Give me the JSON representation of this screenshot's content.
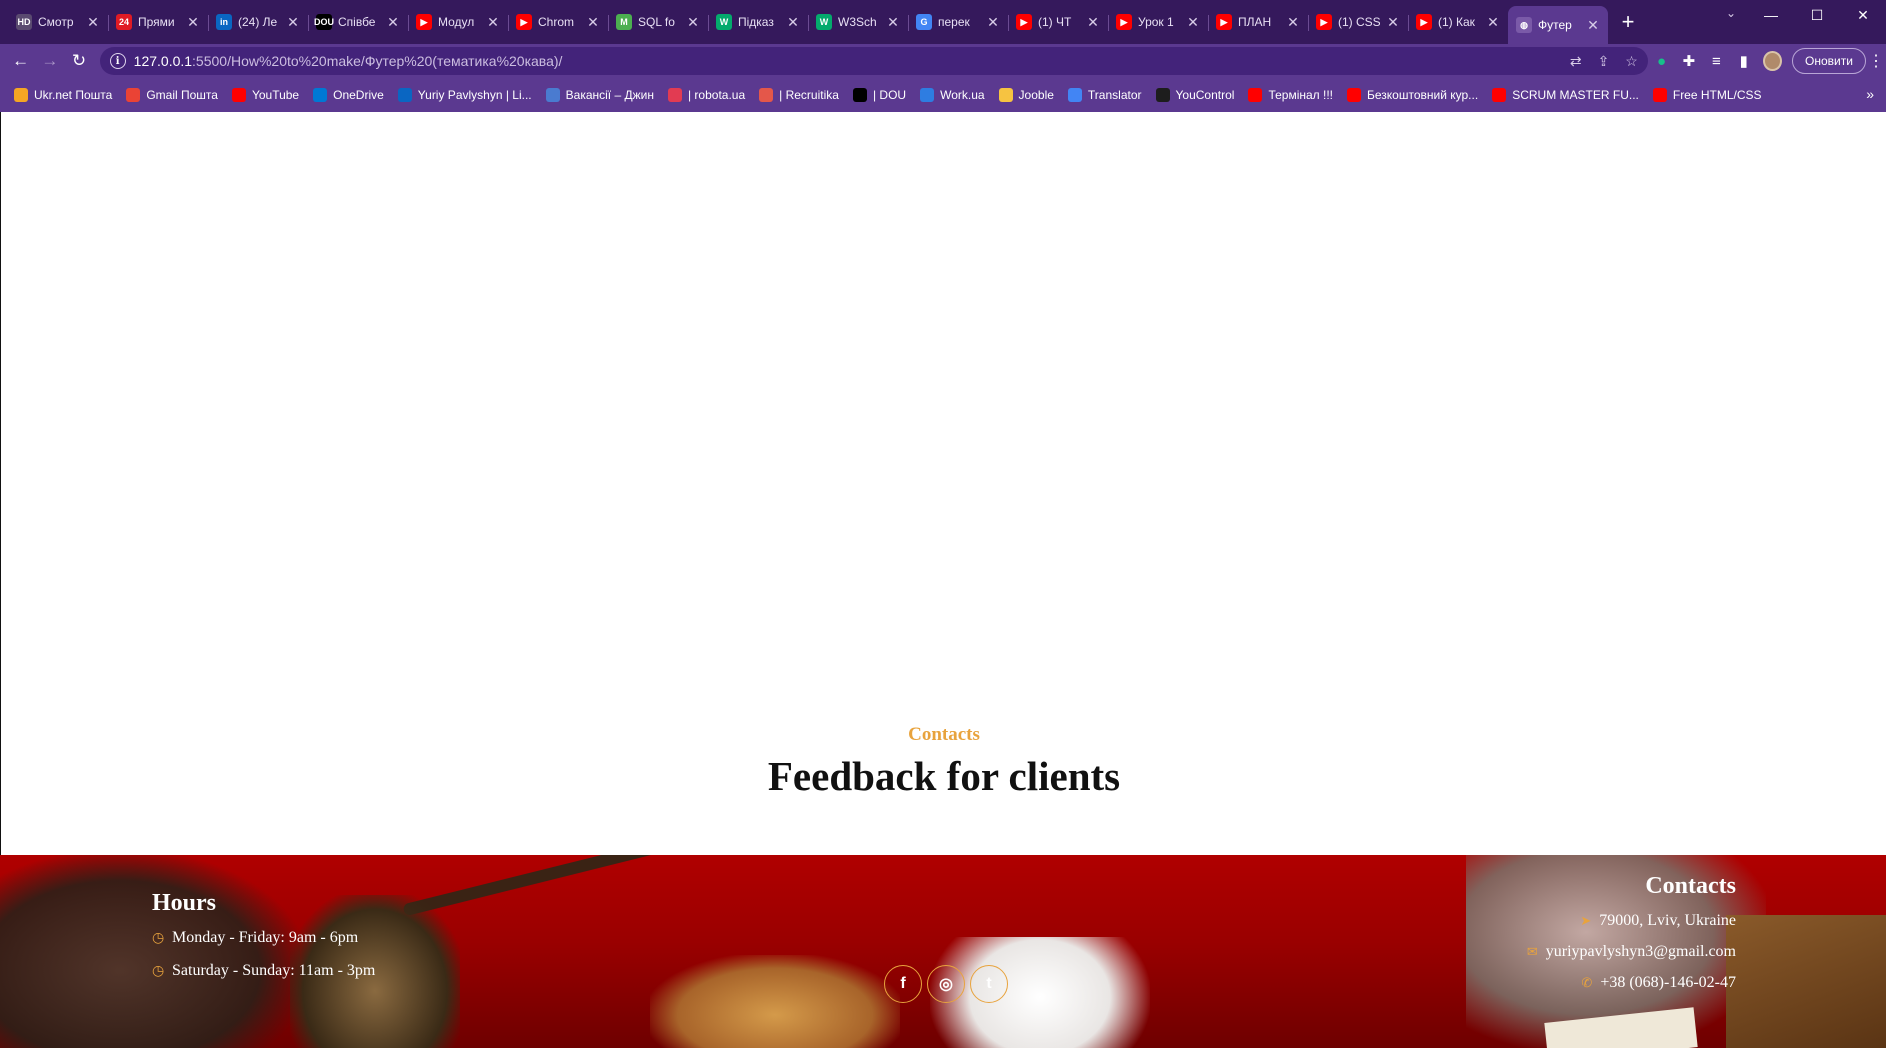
{
  "browser": {
    "tabs": [
      {
        "title": "Смотр",
        "fav": "HD",
        "fav_color": "#5a4a70"
      },
      {
        "title": "Прями",
        "fav": "24",
        "fav_color": "#e01b24"
      },
      {
        "title": "(24) Ле",
        "fav": "in",
        "fav_color": "#0a66c2"
      },
      {
        "title": "Співбе",
        "fav": "DOU",
        "fav_color": "#000000"
      },
      {
        "title": "Модул",
        "fav": "▶",
        "fav_color": "#ff0000"
      },
      {
        "title": "Chrom",
        "fav": "▶",
        "fav_color": "#ff0000"
      },
      {
        "title": "SQL fo",
        "fav": "M",
        "fav_color": "#4caf50"
      },
      {
        "title": "Підказ",
        "fav": "W",
        "fav_color": "#04aa6d"
      },
      {
        "title": "W3Sch",
        "fav": "W",
        "fav_color": "#04aa6d"
      },
      {
        "title": "перек",
        "fav": "G",
        "fav_color": "#4285f4"
      },
      {
        "title": "(1) ЧТ",
        "fav": "▶",
        "fav_color": "#ff0000"
      },
      {
        "title": "Урок 1",
        "fav": "▶",
        "fav_color": "#ff0000"
      },
      {
        "title": "ПЛАН",
        "fav": "▶",
        "fav_color": "#ff0000"
      },
      {
        "title": "(1) CSS",
        "fav": "▶",
        "fav_color": "#ff0000"
      },
      {
        "title": "(1) Как",
        "fav": "▶",
        "fav_color": "#ff0000"
      },
      {
        "title": "Футер",
        "fav": "◍",
        "fav_color": "#7a5aa8",
        "active": true
      }
    ],
    "url_host": "127.0.0.1",
    "url_path": ":5500/How%20to%20make/Футер%20(тематика%20кава)/",
    "update_label": "Оновити",
    "bookmarks": [
      {
        "label": "Ukr.net Пошта",
        "fav_color": "#f5a623"
      },
      {
        "label": "Gmail Пошта",
        "fav_color": "#ea4335"
      },
      {
        "label": "YouTube",
        "fav_color": "#ff0000"
      },
      {
        "label": "OneDrive",
        "fav_color": "#0078d4"
      },
      {
        "label": "Yuriy Pavlyshyn | Li...",
        "fav_color": "#0a66c2"
      },
      {
        "label": "Вакансії – Джин",
        "fav_color": "#4a7bd0"
      },
      {
        "label": "| robota.ua",
        "fav_color": "#e23b52"
      },
      {
        "label": "| Recruitika",
        "fav_color": "#e4574a"
      },
      {
        "label": "| DOU",
        "fav_color": "#000000"
      },
      {
        "label": "Work.ua",
        "fav_color": "#2e7de1"
      },
      {
        "label": "Jooble",
        "fav_color": "#f6c341"
      },
      {
        "label": "Translator",
        "fav_color": "#4285f4"
      },
      {
        "label": "YouControl",
        "fav_color": "#1d1d1d"
      },
      {
        "label": "Термінал !!!",
        "fav_color": "#ff0000"
      },
      {
        "label": "Безкоштовний кур...",
        "fav_color": "#ff0000"
      },
      {
        "label": "SCRUM MASTER FU...",
        "fav_color": "#ff0000"
      },
      {
        "label": "Free HTML/CSS",
        "fav_color": "#ff0000"
      }
    ]
  },
  "page": {
    "eyebrow": "Contacts",
    "headline": "Feedback for clients",
    "accent_color": "#e8a33d",
    "footer": {
      "hours": {
        "title": "Hours",
        "rows": [
          "Monday - Friday: 9am - 6pm",
          "Saturday - Sunday: 11am - 3pm"
        ]
      },
      "contacts": {
        "title": "Contacts",
        "address": "79000, Lviv, Ukraine",
        "email": "yuriypavlyshyn3@gmail.com",
        "phone": "+38 (068)-146-02-47"
      },
      "socials": [
        {
          "name": "facebook",
          "glyph": "f"
        },
        {
          "name": "instagram",
          "glyph": "◎"
        },
        {
          "name": "twitter",
          "glyph": "t"
        }
      ]
    }
  }
}
